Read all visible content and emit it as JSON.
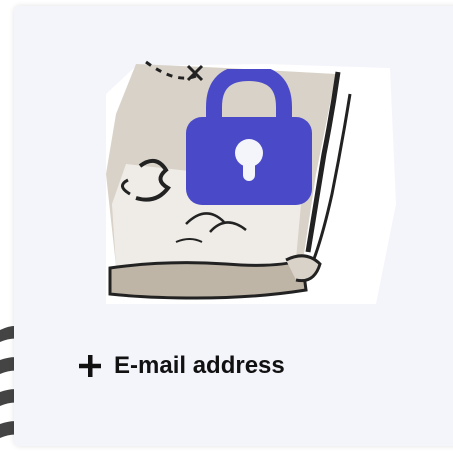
{
  "card": {
    "action_label": "E-mail address",
    "action_icon": "plus-icon",
    "image_icon": "treasure-map-image",
    "badge_icon": "lock-icon"
  },
  "colors": {
    "card_bg": "#f4f4fb",
    "lock": "#4a4ac8",
    "text": "#111111"
  }
}
